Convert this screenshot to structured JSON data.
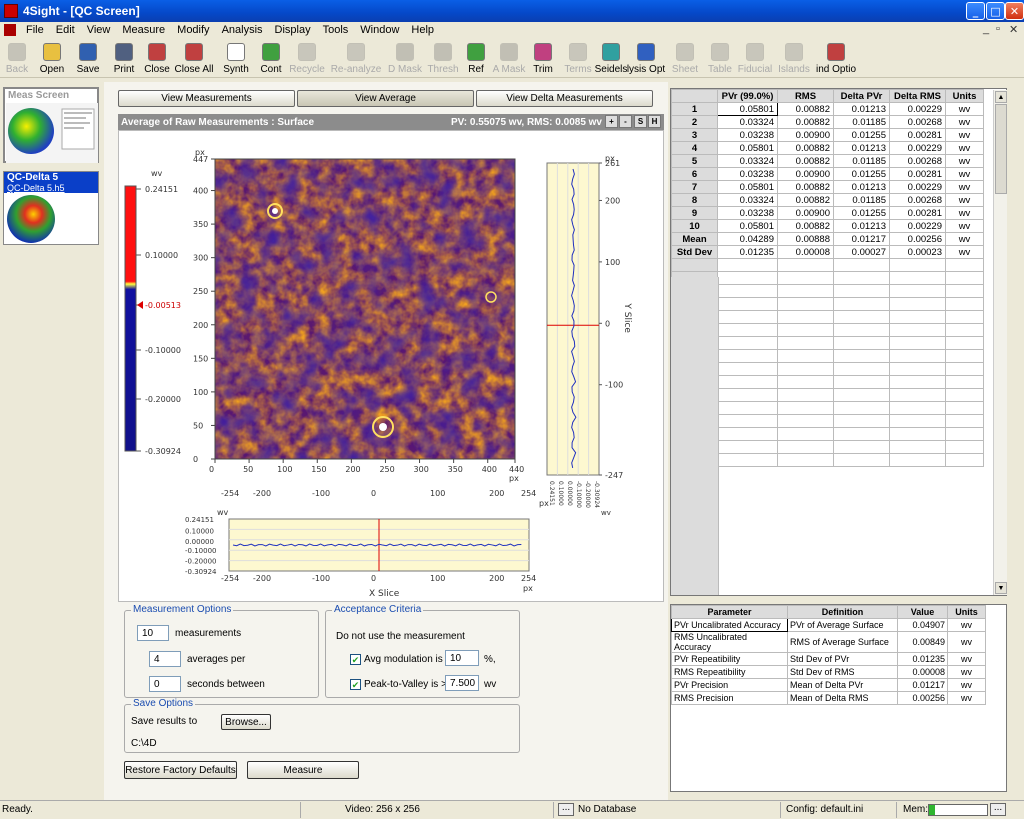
{
  "window": {
    "title": "4Sight - [QC Screen]",
    "controls": {
      "min": "_",
      "max": "□",
      "close": "✕"
    }
  },
  "menu": [
    "File",
    "Edit",
    "View",
    "Measure",
    "Modify",
    "Analysis",
    "Display",
    "Tools",
    "Window",
    "Help"
  ],
  "toolbar": [
    {
      "label": "Back",
      "icon": "back-arrow-icon",
      "enabled": false,
      "color": "#3a9a3a"
    },
    {
      "label": "Open",
      "icon": "folder-open-icon",
      "enabled": true,
      "color": "#e8c040"
    },
    {
      "label": "Save",
      "icon": "floppy-disk-icon",
      "enabled": true,
      "color": "#3060b0"
    },
    {
      "label": "Print",
      "icon": "printer-icon",
      "enabled": true,
      "color": "#506080"
    },
    {
      "label": "Close",
      "icon": "close-document-icon",
      "enabled": true,
      "color": "#c04040"
    },
    {
      "label": "Close All",
      "icon": "close-all-icon",
      "enabled": true,
      "color": "#c04040"
    },
    {
      "label": "Synth",
      "icon": "page-icon",
      "enabled": true,
      "color": "#ffffff"
    },
    {
      "label": "Cont",
      "icon": "continuous-icon",
      "enabled": true,
      "color": "#40a040"
    },
    {
      "label": "Recycle",
      "icon": "recycle-icon",
      "enabled": false,
      "color": "#888888"
    },
    {
      "label": "Re-analyze",
      "icon": "reanalyze-icon",
      "enabled": false,
      "color": "#888888"
    },
    {
      "label": "D Mask",
      "icon": "d-mask-icon",
      "enabled": false,
      "color": "#c06060"
    },
    {
      "label": "Thresh",
      "icon": "threshold-icon",
      "enabled": false,
      "color": "#c06060"
    },
    {
      "label": "Ref",
      "icon": "reference-icon",
      "enabled": true,
      "color": "#40a040"
    },
    {
      "label": "A Mask",
      "icon": "a-mask-icon",
      "enabled": false,
      "color": "#c06060"
    },
    {
      "label": "Trim",
      "icon": "trim-icon",
      "enabled": true,
      "color": "#c04080"
    },
    {
      "label": "Terms",
      "icon": "terms-icon",
      "enabled": false,
      "color": "#888888"
    },
    {
      "label": "Seidels",
      "icon": "seidels-icon",
      "enabled": true,
      "color": "#30a0a0"
    },
    {
      "label": "lysis Opt",
      "icon": "analysis-options-icon",
      "enabled": true,
      "color": "#3060c0"
    },
    {
      "label": "Sheet",
      "icon": "sheet-icon",
      "enabled": false,
      "color": "#888888"
    },
    {
      "label": "Table",
      "icon": "table-icon",
      "enabled": false,
      "color": "#888888"
    },
    {
      "label": "Fiducial",
      "icon": "fiducial-icon",
      "enabled": false,
      "color": "#888888"
    },
    {
      "label": "Islands",
      "icon": "islands-icon",
      "enabled": false,
      "color": "#888888"
    },
    {
      "label": "ind Optio",
      "icon": "wind-options-icon",
      "enabled": true,
      "color": "#c04040"
    }
  ],
  "left_panel": {
    "meas_screen_label": "Meas Screen",
    "qc_item_title": "QC-Delta 5",
    "qc_item_file": "QC-Delta 5.h5"
  },
  "view_buttons": [
    "View Measurements",
    "View Average",
    "View Delta Measurements"
  ],
  "plot": {
    "header_title": "Average of Raw Measurements : Surface",
    "header_stats": "PV: 0.55075 wv, RMS: 0.0085 wv",
    "zoom_buttons": [
      "+",
      "-",
      "S",
      "H"
    ],
    "colorbar_unit": "wv",
    "colorbar_ticks": [
      "0.24151",
      "0.10000",
      "-0.00513",
      "-0.10000",
      "-0.20000",
      "-0.30924"
    ],
    "map_y_unit": "px",
    "map_y_ticks": [
      "447",
      "400",
      "350",
      "300",
      "250",
      "200",
      "150",
      "100",
      "50",
      "0"
    ],
    "map_x_ticks": [
      "0",
      "50",
      "100",
      "150",
      "200",
      "250",
      "300",
      "350",
      "400",
      "440"
    ],
    "map_x_unit": "px",
    "map_x2_ticks": [
      "-254",
      "-200",
      "-100",
      "0",
      "100",
      "200",
      "254"
    ],
    "map_x2_unit": "px",
    "yslice_unit_top": "px",
    "yslice_ticks": [
      "261",
      "200",
      "100",
      "0",
      "-100",
      "-247"
    ],
    "yslice_label": "Y Slice",
    "yslice_bottom_ticks": [
      "0.24151",
      "0.10000",
      "0.00000",
      "-0.10000",
      "-0.20000",
      "-0.30924"
    ],
    "yslice_bottom_unit": "wv",
    "xslice_unit": "wv",
    "xslice_ticks": [
      "0.24151",
      "0.10000",
      "0.00000",
      "-0.10000",
      "-0.20000",
      "-0.30924"
    ],
    "xslice_x_ticks": [
      "-254",
      "-200",
      "-100",
      "0",
      "100",
      "200",
      "254"
    ],
    "xslice_x_unit": "px",
    "xslice_label": "X Slice"
  },
  "measurement_options": {
    "title": "Measurement Options",
    "measurements_value": "10",
    "measurements_label": "measurements",
    "averages_value": "4",
    "averages_label": "averages per",
    "seconds_value": "0",
    "seconds_label": "seconds between"
  },
  "acceptance": {
    "title": "Acceptance Criteria",
    "intro": "Do not use the measurement",
    "mod_label": "Avg modulation is <",
    "mod_value": "10",
    "mod_unit": "%,",
    "pv_label": "Peak-to-Valley is >",
    "pv_value": "7.500",
    "pv_unit": "wv"
  },
  "save_options": {
    "title": "Save Options",
    "label": "Save results to",
    "browse": "Browse...",
    "path": "C:\\4D"
  },
  "buttons": {
    "restore": "Restore Factory Defaults",
    "measure": "Measure"
  },
  "meas_table": {
    "headers": [
      "",
      "PVr (99.0%)",
      "RMS",
      "Delta PVr",
      "Delta RMS",
      "Units"
    ],
    "rows": [
      [
        "1",
        "0.05801",
        "0.00882",
        "0.01213",
        "0.00229",
        "wv"
      ],
      [
        "2",
        "0.03324",
        "0.00882",
        "0.01185",
        "0.00268",
        "wv"
      ],
      [
        "3",
        "0.03238",
        "0.00900",
        "0.01255",
        "0.00281",
        "wv"
      ],
      [
        "4",
        "0.05801",
        "0.00882",
        "0.01213",
        "0.00229",
        "wv"
      ],
      [
        "5",
        "0.03324",
        "0.00882",
        "0.01185",
        "0.00268",
        "wv"
      ],
      [
        "6",
        "0.03238",
        "0.00900",
        "0.01255",
        "0.00281",
        "wv"
      ],
      [
        "7",
        "0.05801",
        "0.00882",
        "0.01213",
        "0.00229",
        "wv"
      ],
      [
        "8",
        "0.03324",
        "0.00882",
        "0.01185",
        "0.00268",
        "wv"
      ],
      [
        "9",
        "0.03238",
        "0.00900",
        "0.01255",
        "0.00281",
        "wv"
      ],
      [
        "10",
        "0.05801",
        "0.00882",
        "0.01213",
        "0.00229",
        "wv"
      ],
      [
        "Mean",
        "0.04289",
        "0.00888",
        "0.01217",
        "0.00256",
        "wv"
      ],
      [
        "Std Dev",
        "0.01235",
        "0.00008",
        "0.00027",
        "0.00023",
        "wv"
      ]
    ],
    "empty_rows": 16
  },
  "param_table": {
    "headers": [
      "Parameter",
      "Definition",
      "Value",
      "Units"
    ],
    "rows": [
      [
        "PVr Uncalibrated Accuracy",
        "PVr of Average Surface",
        "0.04907",
        "wv"
      ],
      [
        "RMS Uncalibrated Accuracy",
        "RMS of Average Surface",
        "0.00849",
        "wv"
      ],
      [
        "PVr Repeatibility",
        "Std Dev of PVr",
        "0.01235",
        "wv"
      ],
      [
        "RMS Repeatibility",
        "Std Dev of RMS",
        "0.00008",
        "wv"
      ],
      [
        "PVr Precision",
        "Mean of Delta PVr",
        "0.01217",
        "wv"
      ],
      [
        "RMS Precision",
        "Mean of Delta RMS",
        "0.00256",
        "wv"
      ]
    ]
  },
  "status": {
    "ready": "Ready.",
    "video": "Video: 256 x 256",
    "db_btn": "...",
    "db": "No Database",
    "config": "Config: default.ini",
    "mem": "Mem:",
    "mem_btn": "...",
    "mem_fraction": 0.1
  }
}
